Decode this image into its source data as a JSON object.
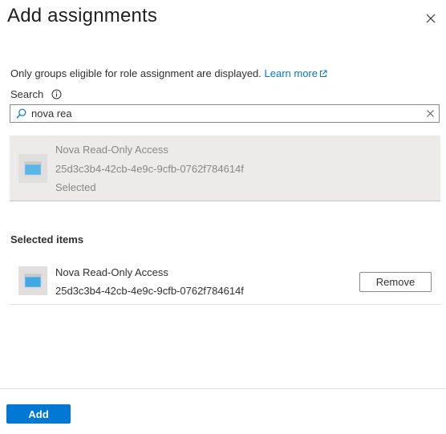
{
  "panel": {
    "title": "Add assignments",
    "close_icon": "close-icon"
  },
  "info": {
    "text": "Only groups eligible for role assignment are displayed.",
    "learn_more": "Learn more",
    "external_icon": "external-link-icon"
  },
  "search": {
    "label": "Search",
    "info_icon": "info-icon",
    "value": "nova rea",
    "placeholder": "",
    "search_icon": "search-icon",
    "clear_icon": "clear-icon"
  },
  "results": [
    {
      "name": "Nova Read-Only Access",
      "id": "25d3c3b4-42cb-4e9c-9cfb-0762f784614f",
      "status": "Selected",
      "icon": "group-icon"
    }
  ],
  "selected": {
    "title": "Selected items",
    "items": [
      {
        "name": "Nova Read-Only Access",
        "id": "25d3c3b4-42cb-4e9c-9cfb-0762f784614f",
        "remove_label": "Remove",
        "icon": "group-icon"
      }
    ]
  },
  "footer": {
    "add_label": "Add"
  },
  "colors": {
    "accent": "#0078d4",
    "selected_bg": "#edebe9",
    "muted_text": "#8a8886"
  }
}
